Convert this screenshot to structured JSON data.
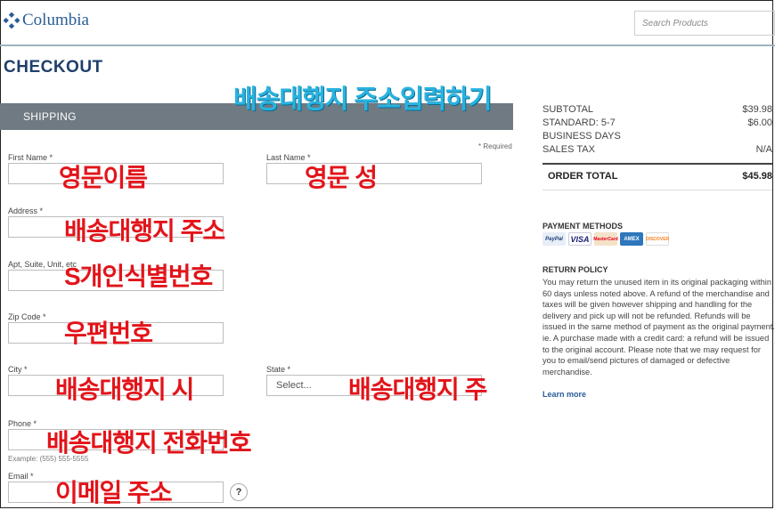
{
  "header": {
    "logo_text": "Columbia",
    "search_placeholder": "Search Products"
  },
  "page_title": "CHECKOUT",
  "section": {
    "title": "SHIPPING",
    "required_note": "* Required"
  },
  "form": {
    "first_name_label": "First Name *",
    "last_name_label": "Last Name *",
    "address_label": "Address *",
    "apt_label": "Apt, Suite, Unit, etc",
    "zip_label": "Zip Code *",
    "city_label": "City *",
    "state_label": "State *",
    "state_selected": "Select...",
    "phone_label": "Phone *",
    "phone_example": "Example: (555) 555-5555",
    "email_label": "Email *",
    "help_label": "?"
  },
  "annotations": {
    "title": "배송대행지 주소입력하기",
    "first_name": "영문이름",
    "last_name": "영문 성",
    "address": "배송대행지 주소",
    "apt": "S개인식별번호",
    "zip": "우편번호",
    "city": "배송대행지 시",
    "state": "배송대행지 주",
    "phone": "배송대행지 전화번호",
    "email": "이메일 주소"
  },
  "summary": {
    "subtotal_label": "SUBTOTAL",
    "subtotal_value": "$39.98",
    "shipping_label": "STANDARD: 5-7",
    "shipping_label2": "BUSINESS DAYS",
    "shipping_value": "$6.00",
    "tax_label": "SALES TAX",
    "tax_value": "N/A",
    "total_label": "ORDER TOTAL",
    "total_value": "$45.98"
  },
  "payment": {
    "title": "PAYMENT METHODS",
    "cards": [
      "PayPal",
      "VISA",
      "MasterCard",
      "AMEX",
      "DISCOVER"
    ],
    "colors": {
      "paypal": "#1f3f7a",
      "visa": "#1a1f71",
      "mastercard": "#eb001b",
      "amex": "#2e77bc",
      "discover": "#f68121"
    }
  },
  "return_policy": {
    "title": "RETURN POLICY",
    "text": "You may return the unused item in its original packaging within 60 days unless noted above. A refund of the merchandise and taxes will be given however shipping and handling for the delivery and pick up will not be refunded. Refunds will be issued in the same method of payment as the original payment. ie. A purchase made with a credit card: a refund will be issued to the original account. Please note that we may request for you to email/send pictures of damaged or defective merchandise.",
    "learn_more": "Learn more"
  }
}
